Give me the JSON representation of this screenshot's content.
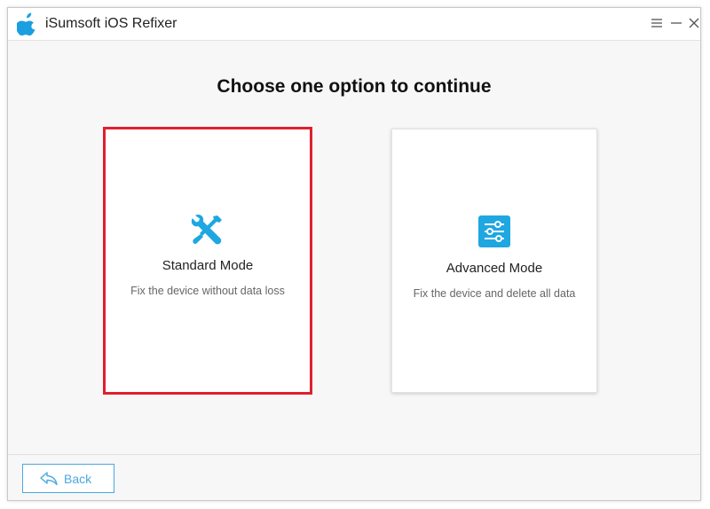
{
  "window": {
    "title": "iSumsoft iOS Refixer",
    "logo_icon": "apple-logo-icon",
    "controls": {
      "menu_icon": "menu-icon",
      "minimize_icon": "minimize-icon",
      "close_icon": "close-icon"
    }
  },
  "main": {
    "heading": "Choose one option to continue",
    "options": [
      {
        "title": "Standard Mode",
        "description": "Fix the device without data loss",
        "icon": "wrench-screwdriver-icon",
        "selected": true
      },
      {
        "title": "Advanced Mode",
        "description": "Fix the device and delete all data",
        "icon": "sliders-icon",
        "selected": false
      }
    ]
  },
  "footer": {
    "back_label": "Back",
    "back_icon": "back-arrow-icon"
  },
  "colors": {
    "accent": "#1ea7e1",
    "selected_border": "#e0202e",
    "back_button": "#4aa8e0"
  }
}
